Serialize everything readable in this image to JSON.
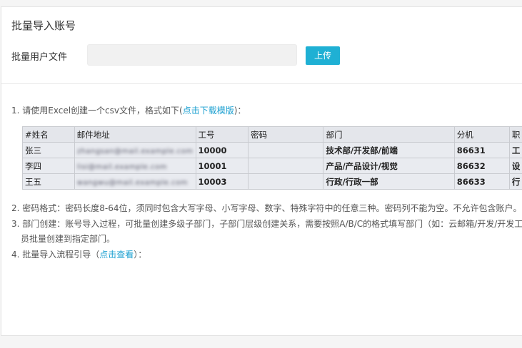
{
  "panel": {
    "title": "批量导入账号",
    "upload_label": "批量用户文件",
    "upload_button": "上传"
  },
  "instructions": {
    "item1_prefix": "1. 请使用Excel创建一个csv文件，格式如下(",
    "item1_link": "点击下载模版",
    "item1_suffix": ")：",
    "item2": "2. 密码格式：密码长度8-64位，须同时包含大写字母、小写字母、数字、特殊字符中的任意三种。密码列不能为空。不允许包含账户。",
    "item3_line1": "3. 部门创建：账号导入过程，可批量创建多级子部门，子部门层级创建关系，需要按照A/B/C的格式填写部门（如：云邮箱/开发/开发工程师",
    "item3_line2": "员批量创建到指定部门。",
    "item4_prefix": "4. 批量导入流程引导（",
    "item4_link": "点击查看",
    "item4_suffix": "）："
  },
  "sample_table": {
    "headers": [
      "#姓名",
      "邮件地址",
      "工号",
      "密码",
      "部门",
      "分机",
      "职"
    ],
    "rows": [
      {
        "name": "张三",
        "email": "zhangsan@mail.example.com",
        "id": "10000",
        "password": "",
        "dept": "技术部/开发部/前端",
        "ext": "86631",
        "title": "工"
      },
      {
        "name": "李四",
        "email": "lisi@mail.example.com",
        "id": "10001",
        "password": "",
        "dept": "产品/产品设计/视觉",
        "ext": "86632",
        "title": "设"
      },
      {
        "name": "王五",
        "email": "wangwu@mail.example.com",
        "id": "10003",
        "password": "",
        "dept": "行政/行政一部",
        "ext": "86633",
        "title": "行"
      }
    ]
  },
  "colors": {
    "accent": "#1fb0d4",
    "link": "#1a9fd0"
  }
}
